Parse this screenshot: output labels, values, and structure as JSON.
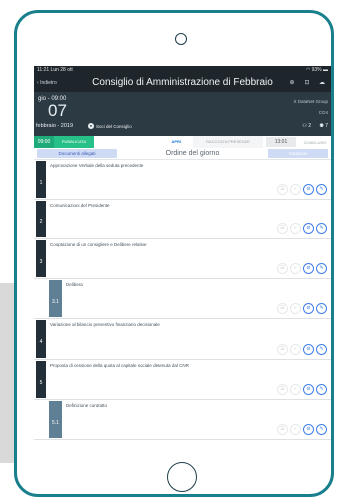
{
  "status": {
    "time": "11:21",
    "date": "Lun 28 ott",
    "battery": "93%"
  },
  "nav": {
    "back": "Indietro",
    "title": "Consiglio di Amministrazione di Febbraio"
  },
  "header": {
    "day_time": "gio - 09:00",
    "day_number": "07",
    "month_year": "febbraio - 2019",
    "soci": "Soci del Consiglio",
    "org": "X DataNet Group",
    "code": "CO4",
    "count_a": "2",
    "count_b": "7"
  },
  "steps": {
    "time": "09:00",
    "published": "PUBBLICATA",
    "open": "APRI",
    "collect": "RACCOLTA PRESENZE",
    "time2": "13:01",
    "concluded": "CONCLUSO"
  },
  "tabs": {
    "documents": "Documenti allegati",
    "agenda": "Ordine del giorno",
    "voting": "Votazioni"
  },
  "agenda": [
    {
      "num": "1",
      "text": "Approvazione Verbale della seduta precedente"
    },
    {
      "num": "2",
      "text": "Comunicazioni del Presidente"
    },
    {
      "num": "3",
      "text": "Cooptazione di un consigliere e Delibere relative"
    },
    {
      "num": "3.1",
      "text": "Delibera"
    },
    {
      "num": "4",
      "text": "Variazione al bilancio preventivo finanziario decisionale"
    },
    {
      "num": "5",
      "text": "Proposta di cessione della quota al capitale sociale detenuta dal CNR"
    },
    {
      "num": "5.1",
      "text": "Definizione contratto"
    }
  ],
  "colors": {
    "frame": "#1a7f8c",
    "header": "#2c3a43",
    "accent": "#3f7ee8",
    "published": "#27c088"
  },
  "icons": {
    "camera": "camera-icon",
    "home": "home-button-icon",
    "action_buttons": [
      "comment-icon",
      "check-icon",
      "attach-icon",
      "edit-icon"
    ]
  }
}
